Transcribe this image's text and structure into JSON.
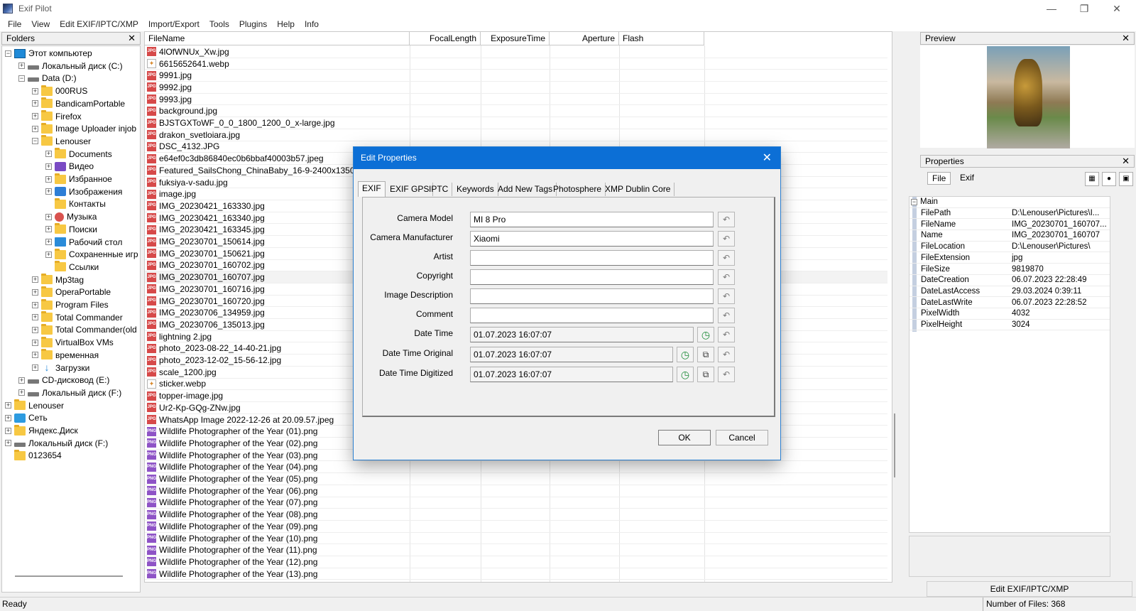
{
  "window": {
    "title": "Exif Pilot",
    "minimize_icon": "—",
    "maximize_icon": "❐",
    "close_icon": "✕"
  },
  "menu": [
    "File",
    "View",
    "Edit EXIF/IPTC/XMP",
    "Import/Export",
    "Tools",
    "Plugins",
    "Help",
    "Info"
  ],
  "folders_panel": {
    "title": "Folders",
    "close": "✕",
    "tree": [
      {
        "label": "Этот компьютер",
        "icon": "computer-icon",
        "exp": "−",
        "level": 0
      },
      {
        "label": "Локальный диск (C:)",
        "icon": "drive-icon",
        "exp": "+",
        "level": 1
      },
      {
        "label": "Data (D:)",
        "icon": "drive-icon",
        "exp": "−",
        "level": 1
      },
      {
        "label": "000RUS",
        "icon": "folder-icon",
        "exp": "+",
        "level": 2
      },
      {
        "label": "BandicamPortable",
        "icon": "folder-icon",
        "exp": "+",
        "level": 2
      },
      {
        "label": "Firefox",
        "icon": "folder-icon",
        "exp": "+",
        "level": 2
      },
      {
        "label": "Image Uploader injob",
        "icon": "folder-icon",
        "exp": "+",
        "level": 2
      },
      {
        "label": "Lenouser",
        "icon": "folder-icon",
        "exp": "−",
        "level": 2
      },
      {
        "label": "Documents",
        "icon": "folder-icon",
        "exp": "+",
        "level": 3
      },
      {
        "label": "Видео",
        "icon": "video-icon",
        "exp": "+",
        "level": 3
      },
      {
        "label": "Избранное",
        "icon": "folder-icon",
        "exp": "+",
        "level": 3
      },
      {
        "label": "Изображения",
        "icon": "pictures-icon",
        "exp": "+",
        "level": 3
      },
      {
        "label": "Контакты",
        "icon": "folder-icon",
        "exp": "",
        "level": 3
      },
      {
        "label": "Музыка",
        "icon": "music-icon",
        "exp": "+",
        "level": 3
      },
      {
        "label": "Поиски",
        "icon": "folder-icon",
        "exp": "+",
        "level": 3
      },
      {
        "label": "Рабочий стол",
        "icon": "desktop-icon",
        "exp": "+",
        "level": 3
      },
      {
        "label": "Сохраненные игр",
        "icon": "folder-icon",
        "exp": "+",
        "level": 3
      },
      {
        "label": "Ссылки",
        "icon": "folder-icon",
        "exp": "",
        "level": 3
      },
      {
        "label": "Mp3tag",
        "icon": "folder-icon",
        "exp": "+",
        "level": 2
      },
      {
        "label": "OperaPortable",
        "icon": "folder-icon",
        "exp": "+",
        "level": 2
      },
      {
        "label": "Program Files",
        "icon": "folder-icon",
        "exp": "+",
        "level": 2
      },
      {
        "label": "Total Commander",
        "icon": "folder-icon",
        "exp": "+",
        "level": 2
      },
      {
        "label": "Total Commander(old",
        "icon": "folder-icon",
        "exp": "+",
        "level": 2
      },
      {
        "label": "VirtualBox VMs",
        "icon": "folder-icon",
        "exp": "+",
        "level": 2
      },
      {
        "label": "временная",
        "icon": "folder-icon",
        "exp": "+",
        "level": 2
      },
      {
        "label": "Загрузки",
        "icon": "download-icon",
        "exp": "+",
        "level": 2
      },
      {
        "label": "CD-дисковод (E:)",
        "icon": "drive-icon",
        "exp": "+",
        "level": 1
      },
      {
        "label": "Локальный диск (F:)",
        "icon": "drive-icon",
        "exp": "+",
        "level": 1
      },
      {
        "label": "Lenouser",
        "icon": "folder-icon",
        "exp": "+",
        "level": 0
      },
      {
        "label": "Сеть",
        "icon": "network-icon",
        "exp": "+",
        "level": 0
      },
      {
        "label": "Яндекс.Диск",
        "icon": "folder-icon",
        "exp": "+",
        "level": 0
      },
      {
        "label": "Локальный диск (F:)",
        "icon": "drive-icon",
        "exp": "+",
        "level": 0
      },
      {
        "label": "0123654",
        "icon": "folder-icon",
        "exp": "",
        "level": 0
      }
    ]
  },
  "file_list": {
    "columns": [
      "FileName",
      "FocalLength",
      "ExposureTime",
      "Aperture",
      "Flash"
    ],
    "files": [
      {
        "name": "4lOfWNUx_Xw.jpg",
        "type": "JPG"
      },
      {
        "name": "6615652641.webp",
        "type": "WEBP"
      },
      {
        "name": "9991.jpg",
        "type": "JPG"
      },
      {
        "name": "9992.jpg",
        "type": "JPG"
      },
      {
        "name": "9993.jpg",
        "type": "JPG"
      },
      {
        "name": "background.jpg",
        "type": "JPG"
      },
      {
        "name": "BJSTGXToWF_0_0_1800_1200_0_x-large.jpg",
        "type": "JPG"
      },
      {
        "name": "drakon_svetloiara.jpg",
        "type": "JPG"
      },
      {
        "name": "DSC_4132.JPG",
        "type": "JPG"
      },
      {
        "name": "e64ef0c3db86840ec0b6bbaf40003b57.jpeg",
        "type": "JPG"
      },
      {
        "name": "Featured_SailsChong_ChinaBaby_16-9-2400x1350.jp",
        "type": "JPG"
      },
      {
        "name": "fuksiya-v-sadu.jpg",
        "type": "JPG"
      },
      {
        "name": "image.jpg",
        "type": "JPG"
      },
      {
        "name": "IMG_20230421_163330.jpg",
        "type": "JPG"
      },
      {
        "name": "IMG_20230421_163340.jpg",
        "type": "JPG"
      },
      {
        "name": "IMG_20230421_163345.jpg",
        "type": "JPG"
      },
      {
        "name": "IMG_20230701_150614.jpg",
        "type": "JPG"
      },
      {
        "name": "IMG_20230701_150621.jpg",
        "type": "JPG"
      },
      {
        "name": "IMG_20230701_160702.jpg",
        "type": "JPG"
      },
      {
        "name": "IMG_20230701_160707.jpg",
        "type": "JPG",
        "selected": true
      },
      {
        "name": "IMG_20230701_160716.jpg",
        "type": "JPG"
      },
      {
        "name": "IMG_20230701_160720.jpg",
        "type": "JPG"
      },
      {
        "name": "IMG_20230706_134959.jpg",
        "type": "JPG"
      },
      {
        "name": "IMG_20230706_135013.jpg",
        "type": "JPG"
      },
      {
        "name": "lightning 2.jpg",
        "type": "JPG"
      },
      {
        "name": "photo_2023-08-22_14-40-21.jpg",
        "type": "JPG"
      },
      {
        "name": "photo_2023-12-02_15-56-12.jpg",
        "type": "JPG"
      },
      {
        "name": "scale_1200.jpg",
        "type": "JPG"
      },
      {
        "name": "sticker.webp",
        "type": "WEBP"
      },
      {
        "name": "topper-image.jpg",
        "type": "JPG"
      },
      {
        "name": "Ur2-Kp-GQg-ZNw.jpg",
        "type": "JPG"
      },
      {
        "name": "WhatsApp Image 2022-12-26 at 20.09.57.jpeg",
        "type": "JPG"
      },
      {
        "name": "Wildlife Photographer of the Year (01).png",
        "type": "PNG"
      },
      {
        "name": "Wildlife Photographer of the Year (02).png",
        "type": "PNG"
      },
      {
        "name": "Wildlife Photographer of the Year (03).png",
        "type": "PNG"
      },
      {
        "name": "Wildlife Photographer of the Year (04).png",
        "type": "PNG"
      },
      {
        "name": "Wildlife Photographer of the Year (05).png",
        "type": "PNG"
      },
      {
        "name": "Wildlife Photographer of the Year (06).png",
        "type": "PNG"
      },
      {
        "name": "Wildlife Photographer of the Year (07).png",
        "type": "PNG"
      },
      {
        "name": "Wildlife Photographer of the Year (08).png",
        "type": "PNG"
      },
      {
        "name": "Wildlife Photographer of the Year (09).png",
        "type": "PNG"
      },
      {
        "name": "Wildlife Photographer of the Year (10).png",
        "type": "PNG"
      },
      {
        "name": "Wildlife Photographer of the Year (11).png",
        "type": "PNG"
      },
      {
        "name": "Wildlife Photographer of the Year (12).png",
        "type": "PNG"
      },
      {
        "name": "Wildlife Photographer of the Year (13).png",
        "type": "PNG"
      }
    ]
  },
  "preview_panel": {
    "title": "Preview",
    "close": "✕"
  },
  "properties_panel": {
    "title": "Properties",
    "close": "✕",
    "tabs": [
      "File",
      "Exif"
    ],
    "group": "Main",
    "rows": [
      {
        "key": "FilePath",
        "value": "D:\\Lenouser\\Pictures\\I..."
      },
      {
        "key": "FileName",
        "value": "IMG_20230701_160707..."
      },
      {
        "key": "Name",
        "value": "IMG_20230701_160707"
      },
      {
        "key": "FileLocation",
        "value": "D:\\Lenouser\\Pictures\\"
      },
      {
        "key": "FileExtension",
        "value": "jpg"
      },
      {
        "key": "FileSize",
        "value": "9819870"
      },
      {
        "key": "DateCreation",
        "value": "06.07.2023 22:28:49"
      },
      {
        "key": "DateLastAccess",
        "value": "29.03.2024 0:39:11"
      },
      {
        "key": "DateLastWrite",
        "value": "06.07.2023 22:28:52"
      },
      {
        "key": "PixelWidth",
        "value": "4032"
      },
      {
        "key": "PixelHeight",
        "value": "3024"
      }
    ],
    "edit_button": "Edit EXIF/IPTC/XMP"
  },
  "status_bar": {
    "left": "Ready",
    "right": "Number of Files: 368"
  },
  "dialog": {
    "title": "Edit Properties",
    "close": "✕",
    "tabs": [
      "EXIF",
      "EXIF GPS",
      "IPTC",
      "Keywords",
      "Add New Tags",
      "Photosphere",
      "XMP Dublin Core"
    ],
    "fields": [
      {
        "label": "Camera Model",
        "value": "MI 8 Pro"
      },
      {
        "label": "Camera Manufacturer",
        "value": "Xiaomi"
      },
      {
        "label": "Artist",
        "value": ""
      },
      {
        "label": "Copyright",
        "value": ""
      },
      {
        "label": "Image Description",
        "value": ""
      },
      {
        "label": "Comment",
        "value": ""
      },
      {
        "label": "Date Time",
        "value": "01.07.2023 16:07:07"
      },
      {
        "label": "Date Time Original",
        "value": "01.07.2023 16:07:07"
      },
      {
        "label": "Date Time Digitized",
        "value": "01.07.2023 16:07:07"
      }
    ],
    "ok": "OK",
    "cancel": "Cancel"
  }
}
